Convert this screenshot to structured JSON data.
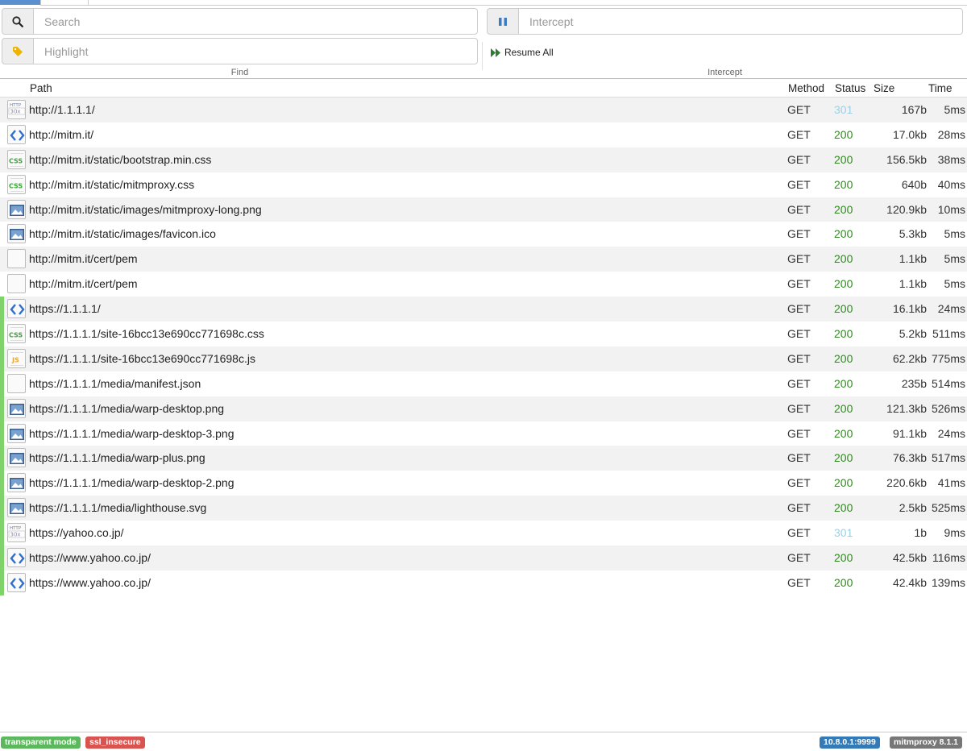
{
  "find": {
    "search_placeholder": "Search",
    "highlight_placeholder": "Highlight",
    "group_label": "Find"
  },
  "intercept": {
    "intercept_placeholder": "Intercept",
    "resume_all_label": "Resume All",
    "group_label": "Intercept"
  },
  "columns": {
    "path": "Path",
    "method": "Method",
    "status": "Status",
    "size": "Size",
    "time": "Time"
  },
  "colors": {
    "status_ok": "#2e8b1e",
    "status_redirect": "#9cd0e6",
    "marker": "#7fd36a",
    "label_green": "#5cb85c",
    "label_red": "#d9534f",
    "label_blue": "#337ab7",
    "label_gray": "#777777"
  },
  "flows": [
    {
      "icon": "redirect-icon",
      "path": "http://1.1.1.1/",
      "method": "GET",
      "status": "301",
      "size": "167b",
      "time": "5ms",
      "marked": false
    },
    {
      "icon": "html-icon",
      "path": "http://mitm.it/",
      "method": "GET",
      "status": "200",
      "size": "17.0kb",
      "time": "28ms",
      "marked": false
    },
    {
      "icon": "css-icon",
      "path": "http://mitm.it/static/bootstrap.min.css",
      "method": "GET",
      "status": "200",
      "size": "156.5kb",
      "time": "38ms",
      "marked": false
    },
    {
      "icon": "css-icon",
      "path": "http://mitm.it/static/mitmproxy.css",
      "method": "GET",
      "status": "200",
      "size": "640b",
      "time": "40ms",
      "marked": false
    },
    {
      "icon": "image-icon",
      "path": "http://mitm.it/static/images/mitmproxy-long.png",
      "method": "GET",
      "status": "200",
      "size": "120.9kb",
      "time": "10ms",
      "marked": false
    },
    {
      "icon": "image-icon",
      "path": "http://mitm.it/static/images/favicon.ico",
      "method": "GET",
      "status": "200",
      "size": "5.3kb",
      "time": "5ms",
      "marked": false
    },
    {
      "icon": "document-icon",
      "path": "http://mitm.it/cert/pem",
      "method": "GET",
      "status": "200",
      "size": "1.1kb",
      "time": "5ms",
      "marked": false
    },
    {
      "icon": "document-icon",
      "path": "http://mitm.it/cert/pem",
      "method": "GET",
      "status": "200",
      "size": "1.1kb",
      "time": "5ms",
      "marked": false
    },
    {
      "icon": "html-icon",
      "path": "https://1.1.1.1/",
      "method": "GET",
      "status": "200",
      "size": "16.1kb",
      "time": "24ms",
      "marked": true
    },
    {
      "icon": "css-icon",
      "path": "https://1.1.1.1/site-16bcc13e690cc771698c.css",
      "method": "GET",
      "status": "200",
      "size": "5.2kb",
      "time": "511ms",
      "marked": true
    },
    {
      "icon": "js-icon",
      "path": "https://1.1.1.1/site-16bcc13e690cc771698c.js",
      "method": "GET",
      "status": "200",
      "size": "62.2kb",
      "time": "775ms",
      "marked": true
    },
    {
      "icon": "document-icon",
      "path": "https://1.1.1.1/media/manifest.json",
      "method": "GET",
      "status": "200",
      "size": "235b",
      "time": "514ms",
      "marked": true
    },
    {
      "icon": "image-icon",
      "path": "https://1.1.1.1/media/warp-desktop.png",
      "method": "GET",
      "status": "200",
      "size": "121.3kb",
      "time": "526ms",
      "marked": true
    },
    {
      "icon": "image-icon",
      "path": "https://1.1.1.1/media/warp-desktop-3.png",
      "method": "GET",
      "status": "200",
      "size": "91.1kb",
      "time": "24ms",
      "marked": true
    },
    {
      "icon": "image-icon",
      "path": "https://1.1.1.1/media/warp-plus.png",
      "method": "GET",
      "status": "200",
      "size": "76.3kb",
      "time": "517ms",
      "marked": true
    },
    {
      "icon": "image-icon",
      "path": "https://1.1.1.1/media/warp-desktop-2.png",
      "method": "GET",
      "status": "200",
      "size": "220.6kb",
      "time": "41ms",
      "marked": true
    },
    {
      "icon": "image-icon",
      "path": "https://1.1.1.1/media/lighthouse.svg",
      "method": "GET",
      "status": "200",
      "size": "2.5kb",
      "time": "525ms",
      "marked": true
    },
    {
      "icon": "redirect-icon",
      "path": "https://yahoo.co.jp/",
      "method": "GET",
      "status": "301",
      "size": "1b",
      "time": "9ms",
      "marked": true
    },
    {
      "icon": "html-icon",
      "path": "https://www.yahoo.co.jp/",
      "method": "GET",
      "status": "200",
      "size": "42.5kb",
      "time": "116ms",
      "marked": true
    },
    {
      "icon": "html-icon",
      "path": "https://www.yahoo.co.jp/",
      "method": "GET",
      "status": "200",
      "size": "42.4kb",
      "time": "139ms",
      "marked": true
    }
  ],
  "footer": {
    "mode_label": "transparent mode",
    "option_label": "ssl_insecure",
    "listen_address": "10.8.0.1:9999",
    "version": "mitmproxy 8.1.1"
  }
}
